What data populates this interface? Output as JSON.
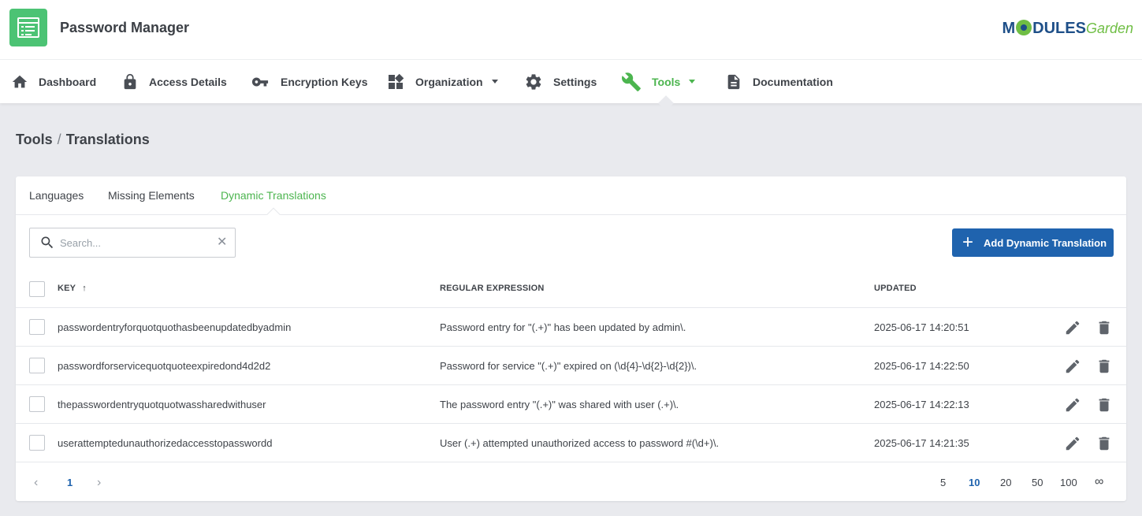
{
  "app": {
    "title": "Password Manager",
    "brand_left": "M",
    "brand_mid": "DULES",
    "brand_right": "Garden"
  },
  "nav": {
    "dashboard": "Dashboard",
    "access_details": "Access Details",
    "encryption_keys": "Encryption Keys",
    "organization": "Organization",
    "settings": "Settings",
    "tools": "Tools",
    "documentation": "Documentation"
  },
  "breadcrumb": {
    "parent": "Tools",
    "separator": "/",
    "current": "Translations"
  },
  "tabs": {
    "languages": "Languages",
    "missing_elements": "Missing Elements",
    "dynamic_translations": "Dynamic Translations"
  },
  "search": {
    "placeholder": "Search...",
    "value": ""
  },
  "add_button": "Add Dynamic Translation",
  "table": {
    "headers": {
      "key": "KEY",
      "sort_indicator": "↑",
      "regex": "REGULAR EXPRESSION",
      "updated": "UPDATED"
    },
    "rows": [
      {
        "key": "passwordentryforquotquothasbeenupdatedbyadmin",
        "regex": "Password entry for \"(.+)\" has been updated by admin\\.",
        "updated": "2025-06-17 14:20:51"
      },
      {
        "key": "passwordforservicequotquoteexpiredond4d2d2",
        "regex": "Password for service \"(.+)\" expired on (\\d{4}-\\d{2}-\\d{2})\\.",
        "updated": "2025-06-17 14:22:50"
      },
      {
        "key": "thepasswordentryquotquotwassharedwithuser",
        "regex": "The password entry \"(.+)\" was shared with user (.+)\\.",
        "updated": "2025-06-17 14:22:13"
      },
      {
        "key": "userattemptedunauthorizedaccesstopasswordd",
        "regex": "User (.+) attempted unauthorized access to password #(\\d+)\\.",
        "updated": "2025-06-17 14:21:35"
      }
    ]
  },
  "pagination": {
    "prev": "‹",
    "next": "›",
    "current_page": "1",
    "per_page_options": [
      "5",
      "10",
      "20",
      "50",
      "100",
      "∞"
    ],
    "per_page_selected": "10"
  },
  "colors": {
    "accent_green": "#4cb54f",
    "primary_blue": "#1f63ae",
    "background": "#e9eaee"
  },
  "icons": {
    "app_logo": "list-window-icon",
    "dashboard": "home-icon",
    "access_details": "lock-icon",
    "encryption_keys": "key-icon",
    "organization": "widgets-icon",
    "settings": "gear-icon",
    "tools": "wrench-icon",
    "documentation": "document-icon",
    "search": "search-icon",
    "clear": "close-icon",
    "edit": "pencil-icon",
    "delete": "trash-icon"
  }
}
